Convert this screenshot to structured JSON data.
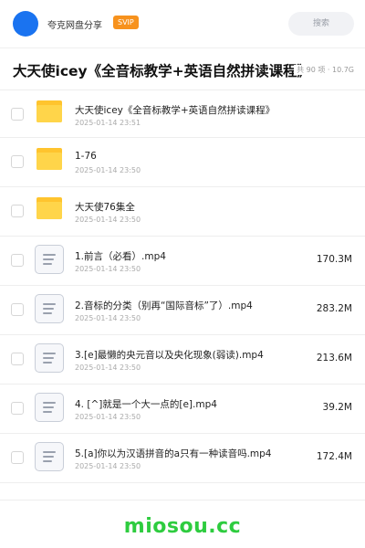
{
  "header": {
    "site_name": "夸克网盘分享",
    "badge": "SVIP",
    "search_placeholder": "搜索"
  },
  "share": {
    "title": "大天使icey《全音标教学+英语自然拼读课程》",
    "meta": "共 90 项 · 10.7G"
  },
  "items": [
    {
      "type": "folder",
      "name": "大天使icey《全音标教学+英语自然拼读课程》",
      "date": "2025-01-14 23:51",
      "size": ""
    },
    {
      "type": "folder",
      "name": "1-76",
      "date": "2025-01-14 23:50",
      "size": ""
    },
    {
      "type": "folder",
      "name": "大天使76集全",
      "date": "2025-01-14 23:50",
      "size": ""
    },
    {
      "type": "file",
      "name": "1.前言（必看）.mp4",
      "date": "2025-01-14 23:50",
      "size": "170.3M"
    },
    {
      "type": "file",
      "name": "2.音标的分类（别再“国际音标”了）.mp4",
      "date": "2025-01-14 23:50",
      "size": "283.2M"
    },
    {
      "type": "file",
      "name": "3.[e]最懒的央元音以及央化现象(弱读).mp4",
      "date": "2025-01-14 23:50",
      "size": "213.6M"
    },
    {
      "type": "file",
      "name": "4. [^]就是一个大一点的[e].mp4",
      "date": "2025-01-14 23:50",
      "size": "39.2M"
    },
    {
      "type": "file",
      "name": "5.[a]你以为汉语拼音的a只有一种读音吗.mp4",
      "date": "2025-01-14 23:50",
      "size": "172.4M"
    }
  ],
  "footer": {
    "brand": "miosou.cc"
  }
}
